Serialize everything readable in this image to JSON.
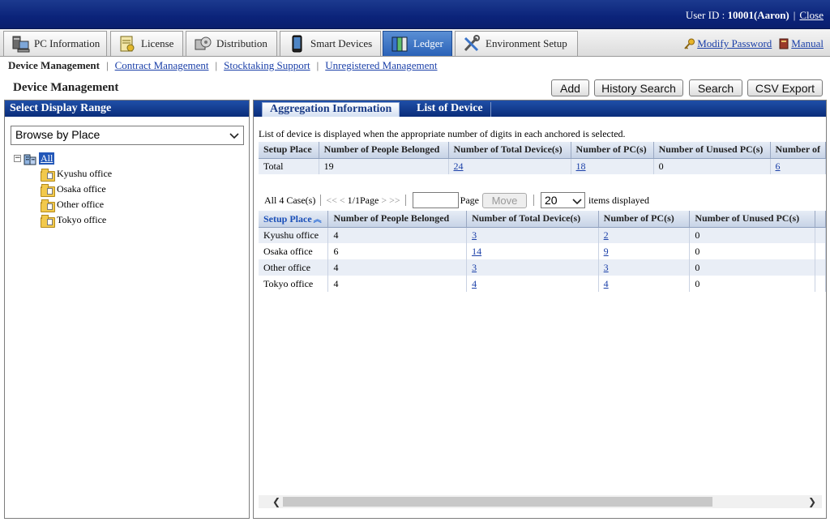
{
  "header": {
    "user_label": "User ID : ",
    "user_value": "10001(Aaron)",
    "close_link": "Close"
  },
  "tabs": [
    {
      "label": "PC Information",
      "icon": "pc-icon"
    },
    {
      "label": "License",
      "icon": "license-icon"
    },
    {
      "label": "Distribution",
      "icon": "distribution-icon"
    },
    {
      "label": "Smart Devices",
      "icon": "smartphone-icon"
    },
    {
      "label": "Ledger",
      "icon": "ledger-icon",
      "active": true
    },
    {
      "label": "Environment Setup",
      "icon": "tools-icon"
    }
  ],
  "toplinks": {
    "modify_password": "Modify Password",
    "manual": "Manual"
  },
  "subnav": {
    "current": "Device Management",
    "links": [
      "Contract Management",
      "Stocktaking Support",
      "Unregistered Management"
    ]
  },
  "page_title": "Device Management",
  "buttons": {
    "add": "Add",
    "history_search": "History Search",
    "search": "Search",
    "csv_export": "CSV Export"
  },
  "left": {
    "title": "Select Display Range",
    "browse_select": "Browse by Place",
    "tree_root": "All",
    "tree_items": [
      "Kyushu office",
      "Osaka office",
      "Other office",
      "Tokyo office"
    ]
  },
  "right": {
    "tabs": [
      "Aggregation Information",
      "List of Device"
    ],
    "info": "List of device is displayed when the appropriate number of digits in each anchored is selected.",
    "summary_headers": [
      "Setup Place",
      "Number of People Belonged",
      "Number of Total Device(s)",
      "Number of PC(s)",
      "Number of Unused PC(s)",
      "Number of"
    ],
    "summary_row": [
      "Total",
      "19",
      "24",
      "18",
      "0",
      "6"
    ],
    "pager": {
      "cases": "All 4 Case(s)",
      "first": "<<",
      "prev": "<",
      "page_of": "1/1Page",
      "next": ">",
      "last": ">>",
      "page_label": "Page",
      "move": "Move",
      "per_page": "20",
      "items_label": "items displayed"
    },
    "detail_headers": [
      "Setup Place",
      "Number of People Belonged",
      "Number of Total Device(s)",
      "Number of PC(s)",
      "Number of Unused PC(s)"
    ],
    "detail_rows": [
      [
        "Kyushu office",
        "4",
        "3",
        "2",
        "0"
      ],
      [
        "Osaka office",
        "6",
        "14",
        "9",
        "0"
      ],
      [
        "Other office",
        "4",
        "3",
        "3",
        "0"
      ],
      [
        "Tokyo office",
        "4",
        "4",
        "4",
        "0"
      ]
    ]
  },
  "colors": {
    "header_blue": "#0b237a",
    "active_tab": "#2a62b8",
    "link": "#1a3fa8"
  }
}
